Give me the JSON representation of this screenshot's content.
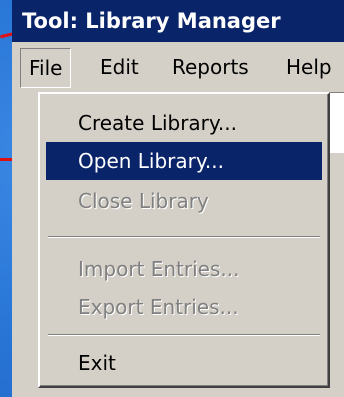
{
  "window": {
    "title": "Tool: Library Manager"
  },
  "menubar": {
    "items": [
      {
        "label": "File"
      },
      {
        "label": "Edit"
      },
      {
        "label": "Reports"
      },
      {
        "label": "Help"
      }
    ]
  },
  "file_menu": {
    "items": [
      {
        "label": "Create Library...",
        "state": "enabled"
      },
      {
        "label": "Open Library...",
        "state": "selected"
      },
      {
        "label": "Close Library",
        "state": "disabled"
      },
      {
        "label": "Import Entries...",
        "state": "disabled"
      },
      {
        "label": "Export Entries...",
        "state": "disabled"
      },
      {
        "label": "Exit",
        "state": "enabled"
      }
    ]
  },
  "colors": {
    "desktop": "#2a78d8",
    "titlebar": "#0a246a",
    "highlight": "#0a246a",
    "face": "#d4d0c8",
    "disabled_text": "#808080",
    "pointer": "#e01010"
  }
}
